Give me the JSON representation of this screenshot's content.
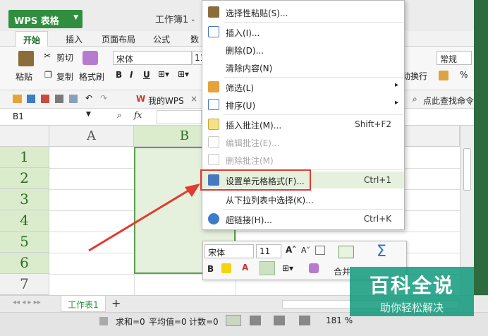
{
  "app": {
    "name": "WPS 表格",
    "doc_title": "工作簿1 -"
  },
  "tabs": [
    "开始",
    "插入",
    "页面布局",
    "公式",
    "数"
  ],
  "ribbon": {
    "paste": "粘贴",
    "cut": "剪切",
    "copy": "复制",
    "format_painter": "格式刷",
    "font": "宋体",
    "font_size": "11",
    "bold": "B",
    "italic": "I",
    "underline": "U",
    "wrap": "动换行",
    "number_format": "常规",
    "percent": "%"
  },
  "qat": {
    "mywps": "我的WPS",
    "find": "点此查找命令"
  },
  "formula": {
    "cell_ref": "B1",
    "fx": "fx"
  },
  "columns": [
    "A",
    "B"
  ],
  "rows": [
    "1",
    "2",
    "3",
    "4",
    "5",
    "6",
    "7"
  ],
  "context_menu": {
    "items": [
      {
        "label": "选择性粘贴(S)...",
        "shortcut": "",
        "enabled": true
      },
      {
        "label": "插入(I)...",
        "shortcut": "",
        "enabled": true
      },
      {
        "label": "删除(D)...",
        "shortcut": "",
        "enabled": true
      },
      {
        "label": "清除内容(N)",
        "shortcut": "",
        "enabled": true
      },
      {
        "label": "筛选(L)",
        "shortcut": "",
        "enabled": true
      },
      {
        "label": "排序(U)",
        "shortcut": "",
        "enabled": true
      },
      {
        "label": "插入批注(M)...",
        "shortcut": "Shift+F2",
        "enabled": true
      },
      {
        "label": "编辑批注(E)...",
        "shortcut": "",
        "enabled": false
      },
      {
        "label": "删除批注(M)",
        "shortcut": "",
        "enabled": false
      },
      {
        "label": "设置单元格格式(F)...",
        "shortcut": "Ctrl+1",
        "enabled": true
      },
      {
        "label": "从下拉列表中选择(K)...",
        "shortcut": "",
        "enabled": true
      },
      {
        "label": "超链接(H)...",
        "shortcut": "Ctrl+K",
        "enabled": true
      }
    ]
  },
  "minibar": {
    "font": "宋体",
    "size": "11",
    "bold": "B",
    "merge": "合并",
    "sum": "Σ"
  },
  "sheet": {
    "tab": "工作表1",
    "add": "+"
  },
  "status": {
    "sum": "求和=0",
    "avg": "平均值=0",
    "count": "计数=0",
    "zoom": "181 %"
  },
  "watermark": {
    "title": "百科全说",
    "subtitle": "助你轻松解决"
  },
  "colors": {
    "accent": "#2f8f3f",
    "highlight": "#dbeccd",
    "annotation": "#e03c31"
  }
}
